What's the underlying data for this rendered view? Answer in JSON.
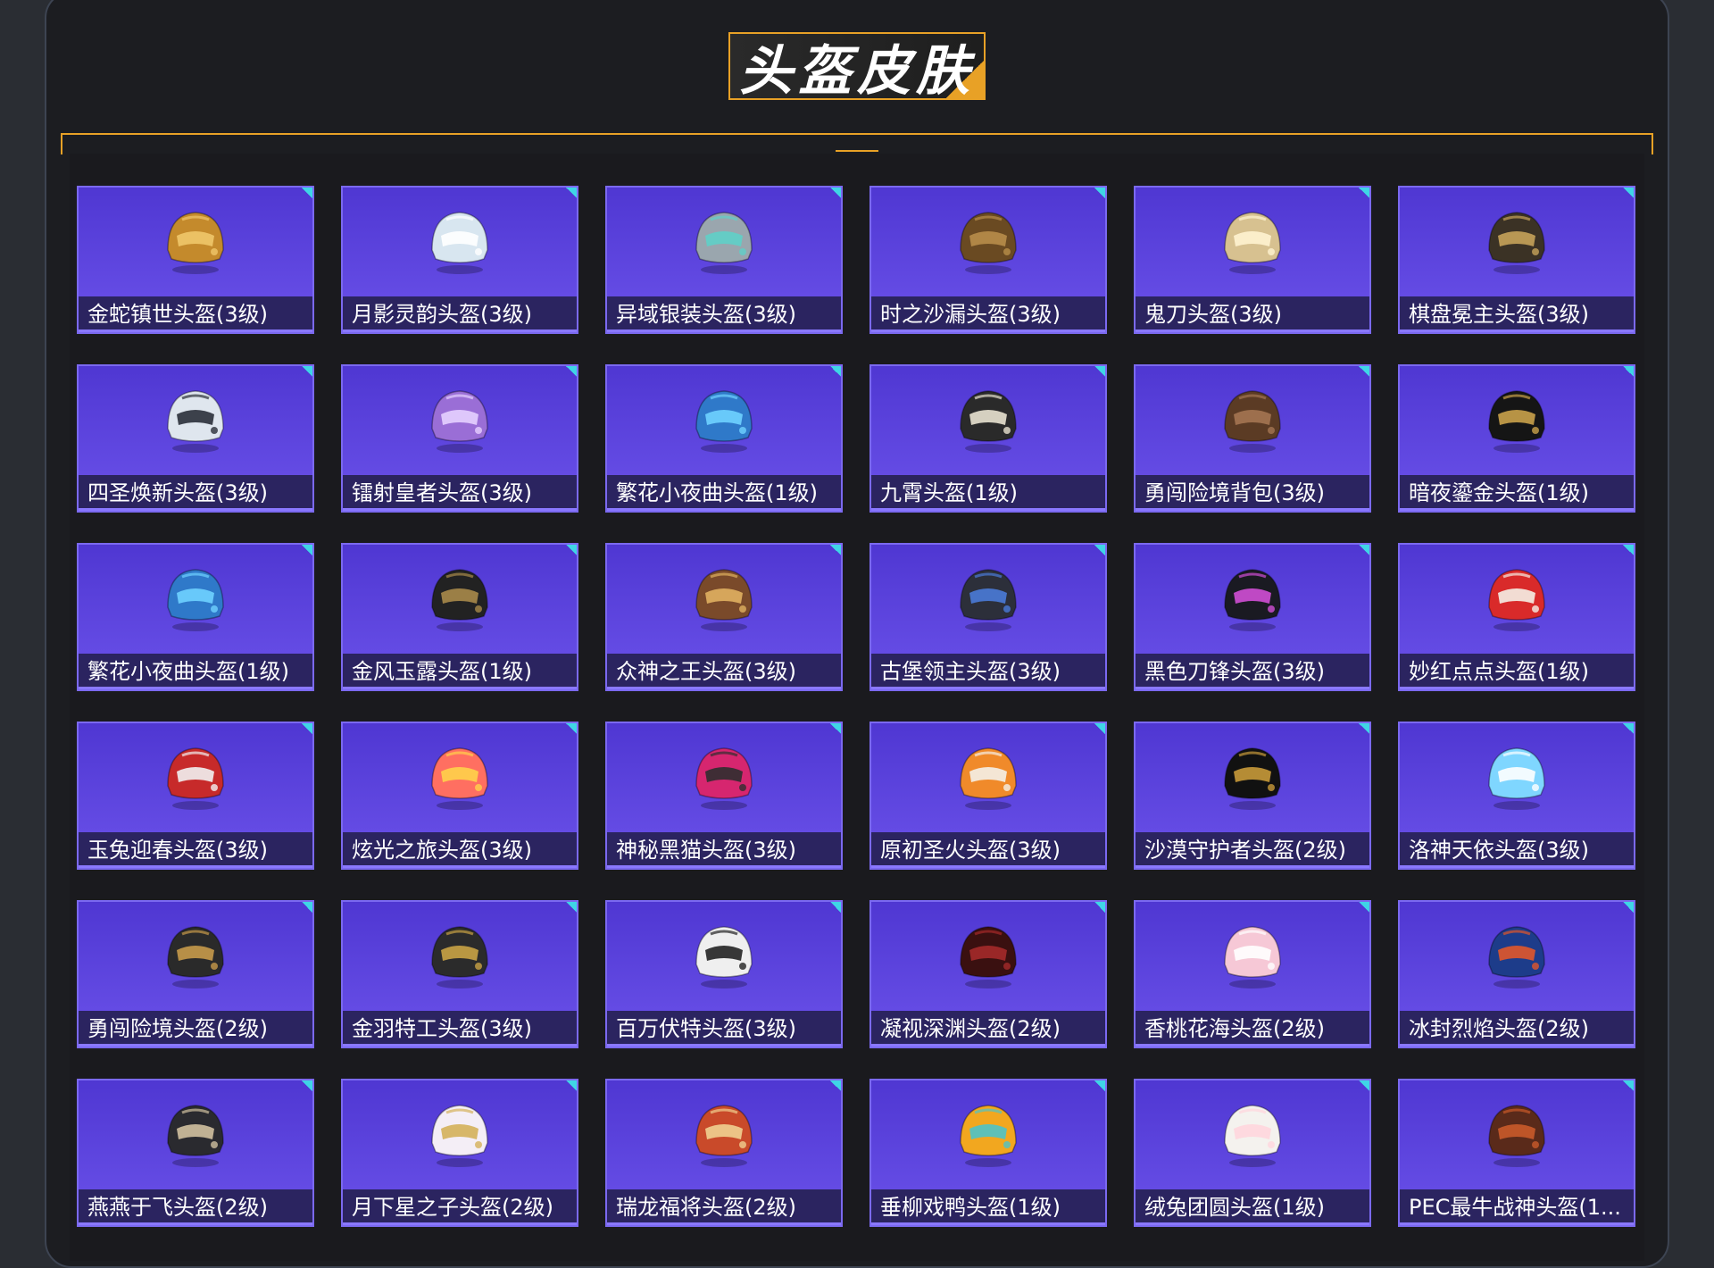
{
  "header": {
    "title": "头盔皮肤"
  },
  "items": [
    {
      "label": "金蛇镇世头盔(3级)",
      "icon": "golden-snake-helmet-icon",
      "c1": "#c48a2c",
      "c2": "#f0c66a"
    },
    {
      "label": "月影灵韵头盔(3级)",
      "icon": "moon-shadow-helmet-icon",
      "c1": "#d8e6f0",
      "c2": "#ffffff"
    },
    {
      "label": "异域银装头盔(3级)",
      "icon": "exotic-silver-helmet-icon",
      "c1": "#9aa6ae",
      "c2": "#5fd0c8"
    },
    {
      "label": "时之沙漏头盔(3级)",
      "icon": "hourglass-helmet-icon",
      "c1": "#6a4a22",
      "c2": "#b88d4a"
    },
    {
      "label": "鬼刀头盔(3级)",
      "icon": "ghost-blade-helmet-icon",
      "c1": "#d7c190",
      "c2": "#fff3d0"
    },
    {
      "label": "棋盘冕主头盔(3级)",
      "icon": "chess-crown-helmet-icon",
      "c1": "#3b3225",
      "c2": "#c7a25a"
    },
    {
      "label": "四圣焕新头盔(3级)",
      "icon": "four-saints-helmet-icon",
      "c1": "#dfe6ee",
      "c2": "#2a2f38"
    },
    {
      "label": "镭射皇者头盔(3级)",
      "icon": "laser-king-helmet-icon",
      "c1": "#9a6ed6",
      "c2": "#e6d0ff"
    },
    {
      "label": "繁花小夜曲头盔(1级)",
      "icon": "flower-serenade-helmet-icon",
      "c1": "#2f79c9",
      "c2": "#6fd2ff"
    },
    {
      "label": "九霄头盔(1级)",
      "icon": "jiuxiao-helmet-icon",
      "c1": "#2a2a2a",
      "c2": "#e8e2d0"
    },
    {
      "label": "勇闯险境背包(3级)",
      "icon": "backpack-icon",
      "c1": "#5b3b24",
      "c2": "#a47652"
    },
    {
      "label": "暗夜鎏金头盔(1级)",
      "icon": "dark-gold-helmet-icon",
      "c1": "#151515",
      "c2": "#c9a14a"
    },
    {
      "label": "繁花小夜曲头盔(1级)",
      "icon": "flower-serenade-helmet-icon",
      "c1": "#2f79c9",
      "c2": "#6fd2ff"
    },
    {
      "label": "金风玉露头盔(1级)",
      "icon": "golden-wind-helmet-icon",
      "c1": "#222222",
      "c2": "#a88a4a"
    },
    {
      "label": "众神之王头盔(3级)",
      "icon": "king-of-gods-helmet-icon",
      "c1": "#7a4a2a",
      "c2": "#e0b060"
    },
    {
      "label": "古堡领主头盔(3级)",
      "icon": "castle-lord-helmet-icon",
      "c1": "#2c2f3a",
      "c2": "#4a7bd8"
    },
    {
      "label": "黑色刀锋头盔(3级)",
      "icon": "black-blade-helmet-icon",
      "c1": "#1a1a22",
      "c2": "#d14fd6"
    },
    {
      "label": "妙红点点头盔(1级)",
      "icon": "red-dots-helmet-icon",
      "c1": "#d92a2a",
      "c2": "#f4efe6"
    },
    {
      "label": "玉兔迎春头盔(3级)",
      "icon": "jade-rabbit-helmet-icon",
      "c1": "#c72a2a",
      "c2": "#f1f1f1"
    },
    {
      "label": "炫光之旅头盔(3级)",
      "icon": "dazzle-journey-helmet-icon",
      "c1": "#ff6f61",
      "c2": "#ffd24a"
    },
    {
      "label": "神秘黑猫头盔(3级)",
      "icon": "mystery-cat-helmet-icon",
      "c1": "#d6266f",
      "c2": "#2f2f2f"
    },
    {
      "label": "原初圣火头盔(3级)",
      "icon": "sacred-fire-helmet-icon",
      "c1": "#f08a2a",
      "c2": "#f4f0e8"
    },
    {
      "label": "沙漠守护者头盔(2级)",
      "icon": "anubis-helmet-icon",
      "c1": "#111111",
      "c2": "#c89a3a"
    },
    {
      "label": "洛神天依头盔(3级)",
      "icon": "luoshen-helmet-icon",
      "c1": "#7fd6ff",
      "c2": "#ffffff"
    },
    {
      "label": "勇闯险境头盔(2级)",
      "icon": "viking-helmet-icon",
      "c1": "#2a2a2a",
      "c2": "#c79a4a"
    },
    {
      "label": "金羽特工头盔(3级)",
      "icon": "golden-feather-helmet-icon",
      "c1": "#2b2b2b",
      "c2": "#c9a345"
    },
    {
      "label": "百万伏特头盔(3级)",
      "icon": "million-volt-helmet-icon",
      "c1": "#efefef",
      "c2": "#222222"
    },
    {
      "label": "凝视深渊头盔(2级)",
      "icon": "abyss-helmet-icon",
      "c1": "#3a1010",
      "c2": "#a52a2a"
    },
    {
      "label": "香桃花海头盔(2级)",
      "icon": "peach-blossom-helmet-icon",
      "c1": "#f6c8d6",
      "c2": "#ffffff"
    },
    {
      "label": "冰封烈焰头盔(2级)",
      "icon": "frozen-flame-helmet-icon",
      "c1": "#1d3c8a",
      "c2": "#e1562a"
    },
    {
      "label": "燕燕于飞头盔(2级)",
      "icon": "swallow-helmet-icon",
      "c1": "#2a2a2f",
      "c2": "#d0c0a0"
    },
    {
      "label": "月下星之子头盔(2级)",
      "icon": "star-child-helmet-icon",
      "c1": "#f4eef6",
      "c2": "#d4b05a"
    },
    {
      "label": "瑞龙福将头盔(2级)",
      "icon": "dragon-general-helmet-icon",
      "c1": "#c94a2a",
      "c2": "#f0d090"
    },
    {
      "label": "垂柳戏鸭头盔(1级)",
      "icon": "willow-duck-helmet-icon",
      "c1": "#f2a71f",
      "c2": "#4ec3c8"
    },
    {
      "label": "绒兔团圆头盔(1级)",
      "icon": "velvet-rabbit-helmet-icon",
      "c1": "#f4f2ee",
      "c2": "#ffd6dd"
    },
    {
      "label": "PEC最牛战神头盔(1...",
      "icon": "pec-war-god-helmet-icon",
      "c1": "#5a2a1a",
      "c2": "#c95a2a"
    }
  ]
}
